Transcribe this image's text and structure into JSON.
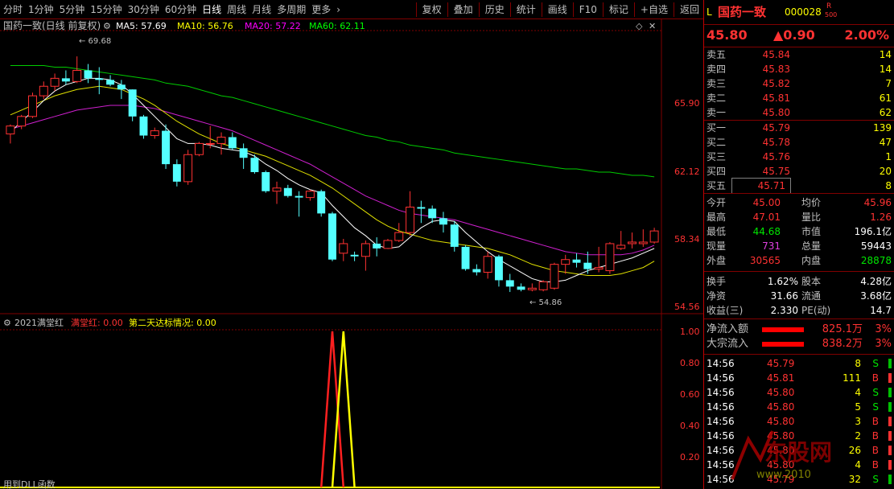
{
  "topbar": {
    "periods": [
      "分时",
      "1分钟",
      "5分钟",
      "15分钟",
      "30分钟",
      "60分钟",
      "日线",
      "周线",
      "月线",
      "多周期",
      "更多"
    ],
    "active": "日线",
    "tools": [
      "复权",
      "叠加",
      "历史",
      "统计",
      "画线",
      "F10",
      "标记",
      "+自选",
      "返回"
    ]
  },
  "chart": {
    "title": "国药一致(日线 前复权)",
    "ma": [
      {
        "name": "MA5",
        "label": "MA5: 57.69",
        "color": "#ffffff"
      },
      {
        "name": "MA10",
        "label": "MA10: 56.76",
        "color": "#ffff00"
      },
      {
        "name": "MA20",
        "label": "MA20: 57.22",
        "color": "#ff00ff"
      },
      {
        "name": "MA60",
        "label": "MA60: 62.11",
        "color": "#00ff00"
      }
    ],
    "price_axis": [
      "65.90",
      "62.12",
      "58.34",
      "54.56"
    ],
    "high_marker": "69.68",
    "low_marker": "54.86"
  },
  "indicator": {
    "name": "2021满堂红",
    "line1": "满堂红: 0.00",
    "line2": "第二天达标情况: 0.00",
    "axis": [
      "1.00",
      "0.80",
      "0.60",
      "0.40",
      "0.20"
    ],
    "footer": "用到DLL函数"
  },
  "chart_data": {
    "type": "candlestick",
    "title": "国药一致(日线 前复权)",
    "ylim": [
      53.8,
      71.0
    ],
    "ticks": [
      65.9,
      62.12,
      58.34,
      54.56
    ],
    "candles": [
      [
        64.8,
        65.4,
        64.2,
        65.3
      ],
      [
        65.3,
        66.0,
        65.1,
        65.9
      ],
      [
        65.9,
        67.4,
        65.8,
        67.2
      ],
      [
        67.2,
        68.1,
        67.0,
        67.8
      ],
      [
        67.8,
        68.6,
        67.5,
        68.3
      ],
      [
        68.3,
        68.8,
        67.9,
        68.1
      ],
      [
        68.1,
        69.68,
        68.0,
        68.8
      ],
      [
        68.8,
        69.2,
        68.0,
        68.3
      ],
      [
        68.3,
        69.0,
        67.3,
        68.2
      ],
      [
        68.2,
        68.5,
        67.8,
        67.9
      ],
      [
        67.9,
        68.2,
        67.0,
        67.6
      ],
      [
        67.6,
        67.6,
        65.6,
        65.9
      ],
      [
        65.9,
        66.0,
        64.5,
        64.7
      ],
      [
        64.7,
        65.2,
        64.5,
        65.0
      ],
      [
        65.0,
        65.4,
        62.6,
        62.9
      ],
      [
        62.9,
        63.2,
        61.5,
        61.8
      ],
      [
        61.8,
        63.8,
        61.6,
        63.5
      ],
      [
        63.5,
        64.3,
        63.4,
        64.2
      ],
      [
        64.2,
        65.3,
        63.9,
        64.2
      ],
      [
        64.2,
        64.9,
        63.5,
        64.6
      ],
      [
        64.6,
        64.9,
        63.8,
        63.9
      ],
      [
        63.9,
        64.2,
        62.6,
        63.3
      ],
      [
        63.3,
        63.5,
        62.3,
        62.4
      ],
      [
        62.4,
        62.5,
        61.1,
        61.2
      ],
      [
        61.2,
        61.8,
        60.4,
        61.4
      ],
      [
        61.4,
        61.6,
        60.8,
        60.9
      ],
      [
        60.9,
        61.2,
        59.6,
        60.8
      ],
      [
        60.8,
        61.3,
        60.6,
        61.2
      ],
      [
        61.2,
        61.3,
        59.6,
        59.8
      ],
      [
        59.8,
        59.9,
        56.8,
        56.9
      ],
      [
        57.3,
        58.2,
        56.8,
        57.9
      ],
      [
        57.2,
        57.4,
        56.8,
        57.1
      ],
      [
        57.1,
        58.1,
        56.2,
        57.9
      ],
      [
        57.9,
        58.3,
        57.1,
        57.6
      ],
      [
        57.6,
        58.2,
        57.6,
        58.1
      ],
      [
        58.1,
        59.2,
        58.0,
        58.6
      ],
      [
        58.6,
        61.2,
        58.4,
        60.2
      ],
      [
        60.2,
        60.6,
        59.2,
        60.1
      ],
      [
        60.1,
        60.3,
        59.2,
        59.5
      ],
      [
        59.5,
        59.9,
        58.6,
        59.1
      ],
      [
        59.1,
        59.3,
        57.4,
        57.7
      ],
      [
        57.7,
        57.8,
        56.2,
        56.3
      ],
      [
        56.3,
        56.6,
        55.9,
        56.1
      ],
      [
        56.1,
        57.4,
        55.7,
        57.1
      ],
      [
        57.1,
        57.2,
        55.2,
        55.6
      ],
      [
        55.6,
        56.0,
        54.86,
        55.2
      ],
      [
        55.2,
        55.4,
        54.9,
        55.0
      ],
      [
        55.0,
        55.4,
        54.9,
        55.1
      ],
      [
        55.0,
        55.6,
        54.9,
        55.5
      ],
      [
        55.1,
        56.7,
        55.0,
        56.6
      ],
      [
        56.6,
        57.2,
        56.0,
        56.9
      ],
      [
        56.9,
        57.3,
        56.4,
        56.7
      ],
      [
        56.7,
        57.4,
        56.0,
        56.3
      ],
      [
        56.3,
        57.7,
        56.1,
        56.4
      ],
      [
        56.2,
        58.0,
        56.0,
        57.9
      ],
      [
        57.6,
        58.7,
        57.5,
        57.8
      ],
      [
        57.9,
        58.6,
        57.6,
        58.0
      ],
      [
        57.9,
        58.8,
        57.7,
        58.0
      ],
      [
        58.0,
        58.9,
        57.9,
        58.7
      ]
    ],
    "ma5": [
      64.9,
      65.6,
      66.2,
      66.9,
      67.5,
      67.9,
      68.1,
      68.3,
      68.3,
      68.2,
      67.9,
      67.3,
      66.6,
      65.9,
      65.2,
      64.5,
      64.2,
      64.2,
      64.1,
      63.9,
      63.8,
      63.7,
      63.4,
      62.9,
      62.5,
      62.0,
      61.6,
      61.3,
      61.1,
      60.3,
      59.6,
      58.9,
      58.4,
      57.8,
      57.6,
      57.7,
      58.3,
      58.9,
      59.3,
      59.4,
      59.3,
      58.6,
      58.0,
      57.4,
      56.9,
      56.5,
      56.1,
      55.7,
      55.5,
      55.5,
      55.6,
      55.9,
      56.2,
      56.4,
      56.6,
      56.8,
      57.0,
      57.3,
      57.6
    ],
    "ma10": [
      66.0,
      66.3,
      66.6,
      66.9,
      67.2,
      67.4,
      67.6,
      67.7,
      67.8,
      67.7,
      67.6,
      67.3,
      67.0,
      66.6,
      66.1,
      65.6,
      65.2,
      64.8,
      64.5,
      64.2,
      64.0,
      63.8,
      63.6,
      63.4,
      63.1,
      62.8,
      62.5,
      62.2,
      61.8,
      61.4,
      60.9,
      60.4,
      59.9,
      59.4,
      59.0,
      58.7,
      58.5,
      58.3,
      58.1,
      58.0,
      57.9,
      57.8,
      57.7,
      57.6,
      57.4,
      57.2,
      56.9,
      56.6,
      56.4,
      56.2,
      56.1,
      56.0,
      55.9,
      55.9,
      55.9,
      56.0,
      56.2,
      56.4,
      56.8
    ],
    "ma20": [
      65.1,
      65.3,
      65.5,
      65.7,
      65.9,
      66.1,
      66.3,
      66.4,
      66.5,
      66.6,
      66.6,
      66.6,
      66.5,
      66.4,
      66.2,
      66.0,
      65.8,
      65.6,
      65.4,
      65.2,
      65.0,
      64.7,
      64.4,
      64.1,
      63.8,
      63.5,
      63.2,
      62.9,
      62.5,
      62.1,
      61.7,
      61.3,
      60.9,
      60.6,
      60.3,
      60.0,
      59.8,
      59.7,
      59.6,
      59.5,
      59.4,
      59.2,
      59.0,
      58.8,
      58.6,
      58.4,
      58.2,
      58.0,
      57.8,
      57.6,
      57.4,
      57.3,
      57.2,
      57.2,
      57.2,
      57.2,
      57.3,
      57.5,
      57.8
    ],
    "ma60": [
      69.1,
      69.1,
      69.1,
      69.1,
      69.0,
      69.0,
      68.9,
      68.8,
      68.7,
      68.6,
      68.5,
      68.4,
      68.3,
      68.2,
      68.0,
      67.9,
      67.8,
      67.6,
      67.4,
      67.2,
      67.1,
      66.9,
      66.7,
      66.5,
      66.3,
      66.1,
      65.9,
      65.7,
      65.5,
      65.3,
      65.1,
      64.9,
      64.7,
      64.6,
      64.4,
      64.3,
      64.1,
      64.0,
      63.9,
      63.8,
      63.6,
      63.5,
      63.4,
      63.3,
      63.2,
      63.1,
      63.0,
      62.9,
      62.8,
      62.7,
      62.6,
      62.6,
      62.5,
      62.4,
      62.4,
      62.3,
      62.2,
      62.2,
      62.1
    ],
    "indicator_series": {
      "ylim": [
        0,
        1.0
      ],
      "ticks": [
        1.0,
        0.8,
        0.6,
        0.4,
        0.2
      ],
      "red_spike_index": 29,
      "yellow_spike_index": 30
    }
  },
  "quote": {
    "code_prefix": "L",
    "name": "国药一致",
    "code": "000028",
    "badge_top": "R",
    "badge_bot": "500",
    "price": "45.80",
    "change": "▲0.90",
    "pct": "2.00%"
  },
  "orderbook": {
    "asks": [
      {
        "label": "卖五",
        "price": "45.84",
        "vol": "14"
      },
      {
        "label": "卖四",
        "price": "45.83",
        "vol": "14"
      },
      {
        "label": "卖三",
        "price": "45.82",
        "vol": "7"
      },
      {
        "label": "卖二",
        "price": "45.81",
        "vol": "61"
      },
      {
        "label": "卖一",
        "price": "45.80",
        "vol": "62"
      }
    ],
    "bids": [
      {
        "label": "买一",
        "price": "45.79",
        "vol": "139"
      },
      {
        "label": "买二",
        "price": "45.78",
        "vol": "47"
      },
      {
        "label": "买三",
        "price": "45.76",
        "vol": "1"
      },
      {
        "label": "买四",
        "price": "45.75",
        "vol": "20"
      },
      {
        "label": "买五",
        "price": "45.71",
        "vol": "8"
      }
    ]
  },
  "stats": [
    {
      "k1": "今开",
      "v1": "45.00",
      "c1": "red",
      "k2": "均价",
      "v2": "45.96",
      "c2": "red"
    },
    {
      "k1": "最高",
      "v1": "47.01",
      "c1": "red",
      "k2": "量比",
      "v2": "1.26",
      "c2": "red"
    },
    {
      "k1": "最低",
      "v1": "44.68",
      "c1": "green",
      "k2": "市值",
      "v2": "196.1亿",
      "c2": "wht"
    },
    {
      "k1": "现量",
      "v1": "731",
      "c1": "pur",
      "k2": "总量",
      "v2": "59443",
      "c2": "wht"
    },
    {
      "k1": "外盘",
      "v1": "30565",
      "c1": "red",
      "k2": "内盘",
      "v2": "28878",
      "c2": "green"
    }
  ],
  "stats2": [
    {
      "k1": "换手",
      "v1": "1.62%",
      "k2": "股本",
      "v2": "4.28亿"
    },
    {
      "k1": "净资",
      "v1": "31.66",
      "k2": "流通",
      "v2": "3.68亿"
    },
    {
      "k1": "收益(三)",
      "v1": "2.330",
      "k2": "PE(动)",
      "v2": "14.7"
    }
  ],
  "flows": [
    {
      "label": "净流入额",
      "value": "825.1万",
      "pct": "3%"
    },
    {
      "label": "大宗流入",
      "value": "838.2万",
      "pct": "3%"
    }
  ],
  "ticks": [
    {
      "t": "14:56",
      "p": "45.79",
      "v": "8",
      "d": "S"
    },
    {
      "t": "14:56",
      "p": "45.81",
      "v": "111",
      "d": "B"
    },
    {
      "t": "14:56",
      "p": "45.80",
      "v": "4",
      "d": "S"
    },
    {
      "t": "14:56",
      "p": "45.80",
      "v": "5",
      "d": "S"
    },
    {
      "t": "14:56",
      "p": "45.80",
      "v": "3",
      "d": "B"
    },
    {
      "t": "14:56",
      "p": "45.80",
      "v": "2",
      "d": "B"
    },
    {
      "t": "14:56",
      "p": "45.80",
      "v": "26",
      "d": "B"
    },
    {
      "t": "14:56",
      "p": "45.80",
      "v": "4",
      "d": "B"
    },
    {
      "t": "14:56",
      "p": "45.79",
      "v": "32",
      "d": "S"
    }
  ],
  "watermark": {
    "text": "东股网",
    "url": "www.2010"
  }
}
